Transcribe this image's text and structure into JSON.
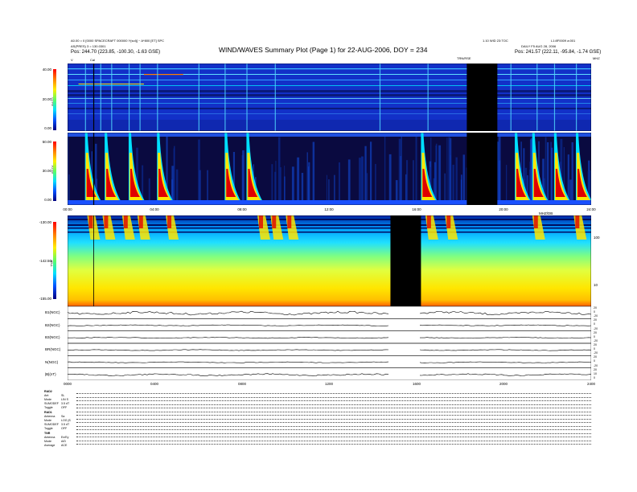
{
  "header": {
    "title": "WIND/WAVES Summary Plot (Page 1) for 22-AUG-2006, DOY = 234",
    "left_line1": "A0.00 = 0 [0000 SPACECRAFT 000000 Y(sol)] ~ A*800 [ET] SPC",
    "left_line2": "AS(PRES) 3 = 130.0301",
    "left_line3": "Pos: 244.70 (223.85, -100.30, -1.63 GSE)",
    "right_top_a": "1.10 WID 23:TOC",
    "right_top_b": "L1:8F0009 a:001",
    "right_line2": "DAILY F5 AUG 28, 2006",
    "right_line3": "Pos: 241.57 (222.11, -95.84, -1.74 GSE)",
    "marker_top": "TRN/RSE",
    "corner_mark": "MHZ",
    "cal_label": "Cal",
    "v_marker": "V"
  },
  "chart_data": [
    {
      "type": "heatmap",
      "panel": "RAD2",
      "ylabel": "RAD2",
      "yticks": [
        "40.00",
        "20.00",
        "0.00"
      ],
      "ylim": [
        0,
        40
      ],
      "xlim": [
        0,
        24
      ],
      "data_gap_hours": [
        18.3,
        19.7
      ]
    },
    {
      "type": "heatmap",
      "panel": "RAD1",
      "ylabel": "RAD1",
      "yticks": [
        "50.00",
        "30.00",
        "0.00"
      ],
      "ylim": [
        0,
        50
      ],
      "xticks": [
        "00:00",
        "04:00",
        "08:00",
        "12:00",
        "16:00",
        "20:00",
        "24:00"
      ],
      "data_gap_hours": [
        18.3,
        19.7
      ],
      "bursts_hours": [
        0.8,
        1.7,
        2.8,
        4.1,
        7.2,
        8.2,
        16.2,
        18.7,
        20.5,
        21.3,
        22.3,
        23.3
      ]
    },
    {
      "type": "heatmap",
      "panel": "TNR",
      "ylabel": "TNR",
      "yticks": [
        "-130.00",
        "-142.50",
        "-155.00"
      ],
      "ylim": [
        -155,
        -130
      ],
      "right_ticks": [
        "100",
        "10"
      ],
      "right_top_label": "MHZ/DB",
      "data_gap_hours": [
        14.8,
        16.2
      ]
    },
    {
      "type": "line",
      "panel": "ancillary",
      "rows": [
        {
          "label": "B1(NGC)",
          "right_ticks": [
            "20",
            "0",
            "-20"
          ]
        },
        {
          "label": "B2(NGC)",
          "right_ticks": [
            "20",
            "0",
            "-20"
          ]
        },
        {
          "label": "B3(NGC)",
          "right_ticks": [
            "20",
            "0",
            "-20"
          ]
        },
        {
          "label": "BR(NGC)",
          "right_ticks": [
            "20",
            "0",
            "-20"
          ]
        },
        {
          "label": "N(NGC)",
          "right_ticks": [
            "20",
            "0",
            "-20"
          ]
        },
        {
          "label": "|B|(nT)",
          "right_ticks": [
            "20",
            "10",
            "0"
          ]
        }
      ],
      "xticks": [
        "0000",
        "0400",
        "0800",
        "1200",
        "1600",
        "2000",
        "2400"
      ]
    }
  ],
  "params": {
    "rad2": {
      "title": "RAD2",
      "lines": [
        [
          "Ant",
          "SL"
        ],
        [
          "Mode",
          "LIN S"
        ],
        [
          "SUMODEF",
          "3.5 dT"
        ],
        [
          "Toggle",
          "OFF"
        ]
      ]
    },
    "rad1": {
      "title": "RAD1",
      "lines": [
        [
          "Antenna",
          "Sa"
        ],
        [
          "Mode",
          "LOG jS"
        ],
        [
          "SUMODEF",
          "3.5 dT"
        ],
        [
          "Toggle",
          "OFF"
        ]
      ]
    },
    "tnr": {
      "title": "TNR",
      "lines": [
        [
          "Antenna",
          "Ex/Ey"
        ],
        [
          "Mode",
          "A/D"
        ],
        [
          "Average",
          "ACE"
        ]
      ]
    }
  },
  "colors": {
    "bg_blue": "#1230c8",
    "deep_blue": "#0a1a7a",
    "cyan": "#00e0ff",
    "yellow": "#ffe600",
    "red": "#e00000",
    "gap": "#000000"
  }
}
